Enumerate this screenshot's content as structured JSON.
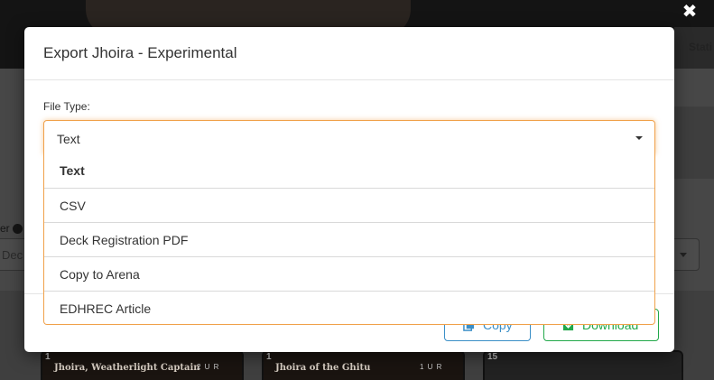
{
  "background": {
    "filter_label_fragment": "er",
    "select_fragment": "Dec",
    "nav_fragment": "Stati",
    "cards": [
      {
        "count": "1",
        "name": "Jhoira, Weatherlight Captain",
        "mana": "2 U R"
      },
      {
        "count": "1",
        "name": "Jhoira of the Ghitu",
        "mana": "1 U R"
      },
      {
        "count": "15",
        "name": "",
        "mana": ""
      }
    ]
  },
  "modal": {
    "title": "Export Jhoira - Experimental",
    "close_glyph": "✖",
    "file_type_label": "File Type:",
    "selected_value": "Text",
    "options": [
      {
        "label": "Text",
        "selected": true
      },
      {
        "label": "CSV",
        "selected": false
      },
      {
        "label": "Deck Registration PDF",
        "selected": false
      },
      {
        "label": "Copy to Arena",
        "selected": false
      },
      {
        "label": "EDHREC Article",
        "selected": false
      }
    ],
    "buttons": {
      "copy_label": "Copy",
      "download_label": "Download"
    }
  },
  "colors": {
    "focus_border": "#f0a14a",
    "copy_blue": "#3b8fc7",
    "download_green": "#22a84a"
  }
}
